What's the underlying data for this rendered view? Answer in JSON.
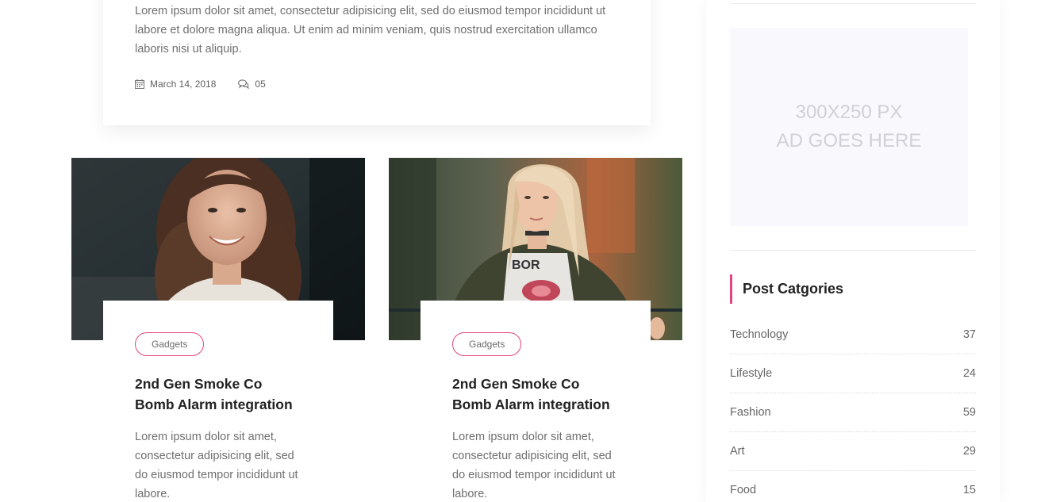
{
  "featured_post": {
    "excerpt": "Lorem ipsum dolor sit amet, consectetur adipisicing elit, sed do eiusmod tempor incididunt ut labore et dolore magna aliqua. Ut enim ad minim veniam, quis nostrud exercitation ullamco laboris nisi ut aliquip.",
    "date": "March 14, 2018",
    "comments": "05",
    "date_icon": "calendar-icon",
    "comments_icon": "comments-icon"
  },
  "posts": [
    {
      "tag": "Gadgets",
      "title": "2nd Gen Smoke Co Bomb Alarm integration",
      "excerpt": "Lorem ipsum dolor sit amet, consectetur adipisicing elit, sed do eiusmod tempor incididunt ut labore."
    },
    {
      "tag": "Gadgets",
      "title": "2nd Gen Smoke Co Bomb Alarm integration",
      "excerpt": "Lorem ipsum dolor sit amet, consectetur adipisicing elit, sed do eiusmod tempor incididunt ut labore."
    }
  ],
  "sidebar": {
    "ad": {
      "line1": "300X250 PX",
      "line2": "AD GOES HERE"
    },
    "categories_title": "Post Catgories",
    "categories": [
      {
        "name": "Technology",
        "count": "37"
      },
      {
        "name": "Lifestyle",
        "count": "24"
      },
      {
        "name": "Fashion",
        "count": "59"
      },
      {
        "name": "Art",
        "count": "29"
      },
      {
        "name": "Food",
        "count": "15"
      }
    ]
  },
  "colors": {
    "accent": "#e3437f",
    "heading": "#222222",
    "body_text": "#6f6f6f"
  }
}
